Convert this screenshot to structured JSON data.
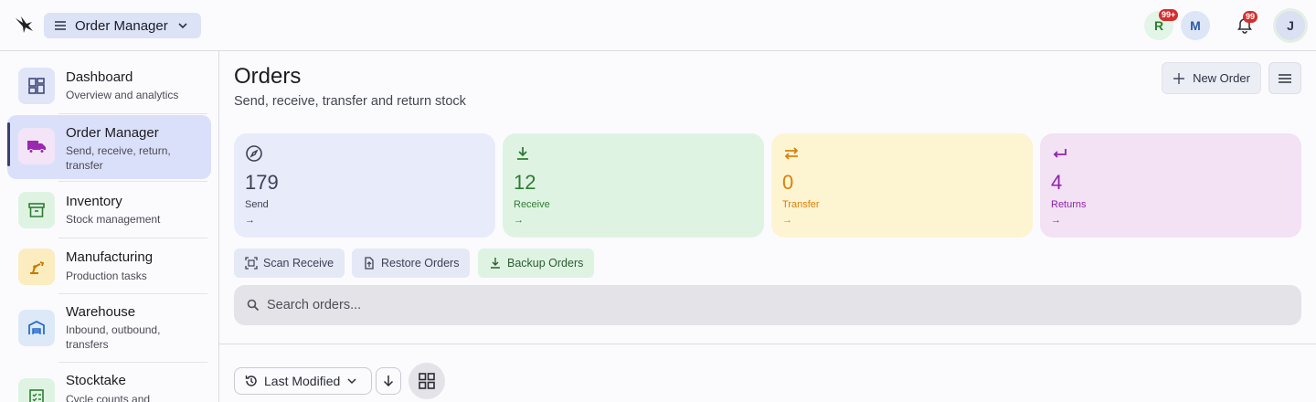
{
  "header": {
    "app_switcher_label": "Order Manager",
    "avatars": [
      {
        "initial": "R",
        "badge": "99+",
        "bg": "#e2f5e6",
        "fg": "#2e7d32"
      },
      {
        "initial": "M",
        "bg": "#dde6f7",
        "fg": "#2f5aa8"
      },
      {
        "initial": "J",
        "bg": "#dbe0f2",
        "fg": "#2f3550"
      }
    ],
    "notifications_badge": "99"
  },
  "sidebar": {
    "items": [
      {
        "title": "Dashboard",
        "subtitle": "Overview and analytics",
        "icon": "dashboard-icon",
        "icon_bg": "#e0e5f8",
        "icon_color": "#3f4a78"
      },
      {
        "title": "Order Manager",
        "subtitle": "Send, receive, return, transfer",
        "icon": "truck-icon",
        "icon_bg": "#f3e4f7",
        "icon_color": "#9c27b0",
        "active": true
      },
      {
        "title": "Inventory",
        "subtitle": "Stock management",
        "icon": "archive-box-icon",
        "icon_bg": "#dff3e3",
        "icon_color": "#2e7d32"
      },
      {
        "title": "Manufacturing",
        "subtitle": "Production tasks",
        "icon": "robot-arm-icon",
        "icon_bg": "#fbedc0",
        "icon_color": "#c77800"
      },
      {
        "title": "Warehouse",
        "subtitle": "Inbound, outbound, transfers",
        "icon": "warehouse-icon",
        "icon_bg": "#dde9f7",
        "icon_color": "#1e66c8"
      },
      {
        "title": "Stocktake",
        "subtitle": "Cycle counts and",
        "icon": "checklist-icon",
        "icon_bg": "#dff3e3",
        "icon_color": "#2e7d32"
      }
    ]
  },
  "page": {
    "title": "Orders",
    "subtitle": "Send, receive, transfer and return stock",
    "new_order_label": "New Order"
  },
  "cards": [
    {
      "value": "179",
      "label": "Send",
      "arrow": "→",
      "bg": "#e7ebfa",
      "fg": "#3c4255",
      "icon": "compass-icon"
    },
    {
      "value": "12",
      "label": "Receive",
      "arrow": "→",
      "bg": "#dff3e3",
      "fg": "#2e7d32",
      "icon": "download-icon"
    },
    {
      "value": "0",
      "label": "Transfer",
      "arrow": "→",
      "bg": "#fdf4d2",
      "fg": "#d9810a",
      "icon": "swap-arrows-icon"
    },
    {
      "value": "4",
      "label": "Returns",
      "arrow": "→",
      "bg": "#f3e1f4",
      "fg": "#8e24aa",
      "icon": "return-arrow-icon"
    }
  ],
  "actions": [
    {
      "label": "Scan Receive",
      "icon": "scan-icon",
      "bg": "#e5e8f5",
      "fg": "#3c4255"
    },
    {
      "label": "Restore Orders",
      "icon": "file-restore-icon",
      "bg": "#e5e8f5",
      "fg": "#3c4255"
    },
    {
      "label": "Backup Orders",
      "icon": "download-icon",
      "bg": "#dff3e3",
      "fg": "#2e5c33"
    }
  ],
  "search": {
    "placeholder": "Search orders...",
    "value": ""
  },
  "sort": {
    "selected": "Last Modified"
  }
}
